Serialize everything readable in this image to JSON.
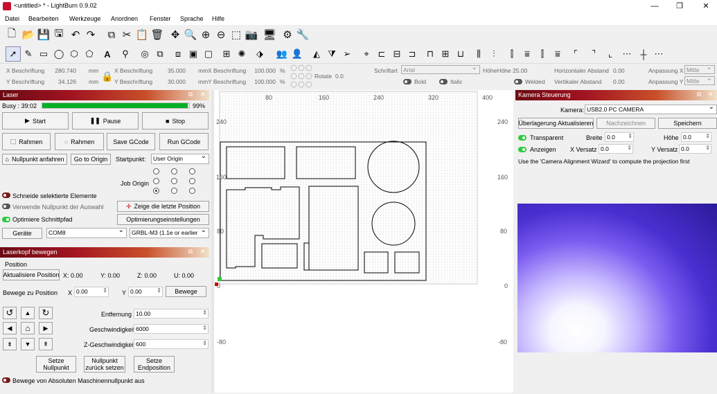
{
  "window": {
    "title": "<untitled> * - LightBurn 0.9.02",
    "minimize": "—",
    "maximize": "❐",
    "close": "✕"
  },
  "menu": [
    "Datei",
    "Bearbeiten",
    "Werkzeuge",
    "Anordnen",
    "Fenster",
    "Sprache",
    "Hilfe"
  ],
  "toolbar1_icons": [
    "new-file-icon",
    "open-folder-icon",
    "save-icon",
    "save-as-icon",
    "undo-icon",
    "redo-icon",
    "copy-icon",
    "cut-icon",
    "paste-icon",
    "delete-icon",
    "move-icon",
    "zoom-to-page-icon",
    "zoom-in-icon",
    "zoom-out-icon",
    "zoom-frame-icon",
    "camera-capture-icon",
    "monitor-icon",
    "settings-gear-icon",
    "tools-icon"
  ],
  "toolbar2_icons": [
    "select-cursor-icon",
    "pencil-icon",
    "rectangle-icon",
    "ellipse-icon",
    "polygon-icon",
    "pentagon-icon",
    "text-tool-icon",
    "position-marker-icon",
    "offset-icon",
    "boolean-union-icon",
    "weld-icon",
    "group-icon",
    "ungroup-icon",
    "grid-array-icon",
    "circular-array-icon",
    "tag-icon",
    "users-icon",
    "user-icon",
    "mirror-h-icon",
    "mirror-v-icon",
    "send-icon",
    "target-icon",
    "align-left-icon",
    "align-center-icon",
    "align-right-icon",
    "align-top-icon",
    "align-middle-icon",
    "align-bottom-icon",
    "distribute-h-icon",
    "distribute-v-icon",
    "space-h-icon",
    "space-v-icon",
    "corner-tl-icon",
    "corner-tr-icon",
    "dash-icon",
    "crosshair-icon"
  ],
  "props": {
    "x_label": "X Beschriftung",
    "x_val": "280.740",
    "mm1": "mm",
    "y_label": "Y Beschriftung",
    "y_val": "34.126",
    "mm2": "mm",
    "w_label": "X Beschriftung",
    "w_val": "35.000",
    "mm3": "mm",
    "h_label": "Y Beschriftung",
    "h_val": "30.000",
    "mm4": "mm",
    "sx_label": "X Beschriftung",
    "sx_val": "100.000",
    "pct1": "%",
    "sy_label": "Y Beschriftung",
    "sy_val": "100.000",
    "pct2": "%",
    "rotate_label": "Rotate",
    "rotate_val": "0.0",
    "font_label": "Schriftart",
    "font_val": "Arial",
    "height_label": "HöheHöhe",
    "height_val": "25.00",
    "hspace_label": "Horizontaler Abstand",
    "hspace_val": "0.00",
    "vspace_label": "Vertikaler Abstand",
    "vspace_val": "0.00",
    "alignx_label": "Anpassung X",
    "alignx_val": "Mitte",
    "aligny_label": "Anpassung Y",
    "aligny_val": "Mitte",
    "bold": "Bold",
    "italic": "Italic",
    "welded": "Welded"
  },
  "laser": {
    "title": "Laser",
    "busy": "Busy : 39:02",
    "progress_pct": 99,
    "progress_text": "99%",
    "start": "Start",
    "pause": "Pause",
    "stop": "Stop",
    "frame1": "Rahmen",
    "frame2": "Rahmen",
    "save_gcode": "Save GCode",
    "run_gcode": "Run GCode",
    "home": "Nullpunkt anfahren",
    "go_origin": "Go to Origin",
    "start_from_label": "Startpunkt:",
    "start_from": "User Origin",
    "job_origin": "Job Origin",
    "cut_selected": "Schneide selektierte Elemente",
    "use_selection_origin": "Verwende Nullpunkt der Auswahl",
    "show_last": "Zeige die letzte Position",
    "optimize": "Optimiere Schnittpfad",
    "opt_settings": "Optimierungseinstellungen",
    "devices": "Geräte",
    "port": "COM8",
    "device": "GRBL-M3 (1.1e or earlier"
  },
  "move": {
    "title": "Laserkopf bewegen",
    "position": "Position",
    "update_pos": "Aktualisiere Position",
    "x": "X: 0.00",
    "y": "Y: 0.00",
    "z": "Z: 0.00",
    "u": "U: 0.00",
    "move_to": "Bewege zu Position",
    "mx_label": "X",
    "mx": "0.00",
    "my_label": "Y",
    "my": "0.00",
    "move_btn": "Bewege",
    "distance_label": "Entfernung",
    "distance": "10.00",
    "speed_label": "Geschwindigkeit",
    "speed": "6000",
    "zspeed_label": "Z-Geschwindigkeit",
    "zspeed": "600",
    "set_origin": "Setze\nNullpunkt",
    "reset_origin": "Nullpunkt\nzurück setzen",
    "set_finish": "Setze\nEndposition",
    "abs_move": "Bewege von Absoluten Maschinennullpunkt aus"
  },
  "ruler": {
    "top": [
      "80",
      "160",
      "240",
      "320",
      "400"
    ],
    "left": [
      "240",
      "160",
      "80",
      "0",
      "-80"
    ],
    "right": [
      "240",
      "160",
      "80",
      "0",
      "-80"
    ]
  },
  "camera": {
    "title": "Kamera Steuerung",
    "camera_label": "Kamera:",
    "camera": "USB2.0 PC CAMERA",
    "update_overlay": "Überlagerung Aktualisieren",
    "trace": "Nachzeichnen",
    "save": "Speichern",
    "transparent": "Transparent",
    "width_label": "Breite",
    "width": "0.0",
    "height_label": "Höhe",
    "height": "0.0",
    "show": "Anzeigen",
    "xoff_label": "X Versatz",
    "xoff": "0.0",
    "yoff_label": "Y Versatz",
    "yoff": "0.0",
    "hint": "Use the 'Camera Alignment Wizard' to compute the projection first"
  }
}
